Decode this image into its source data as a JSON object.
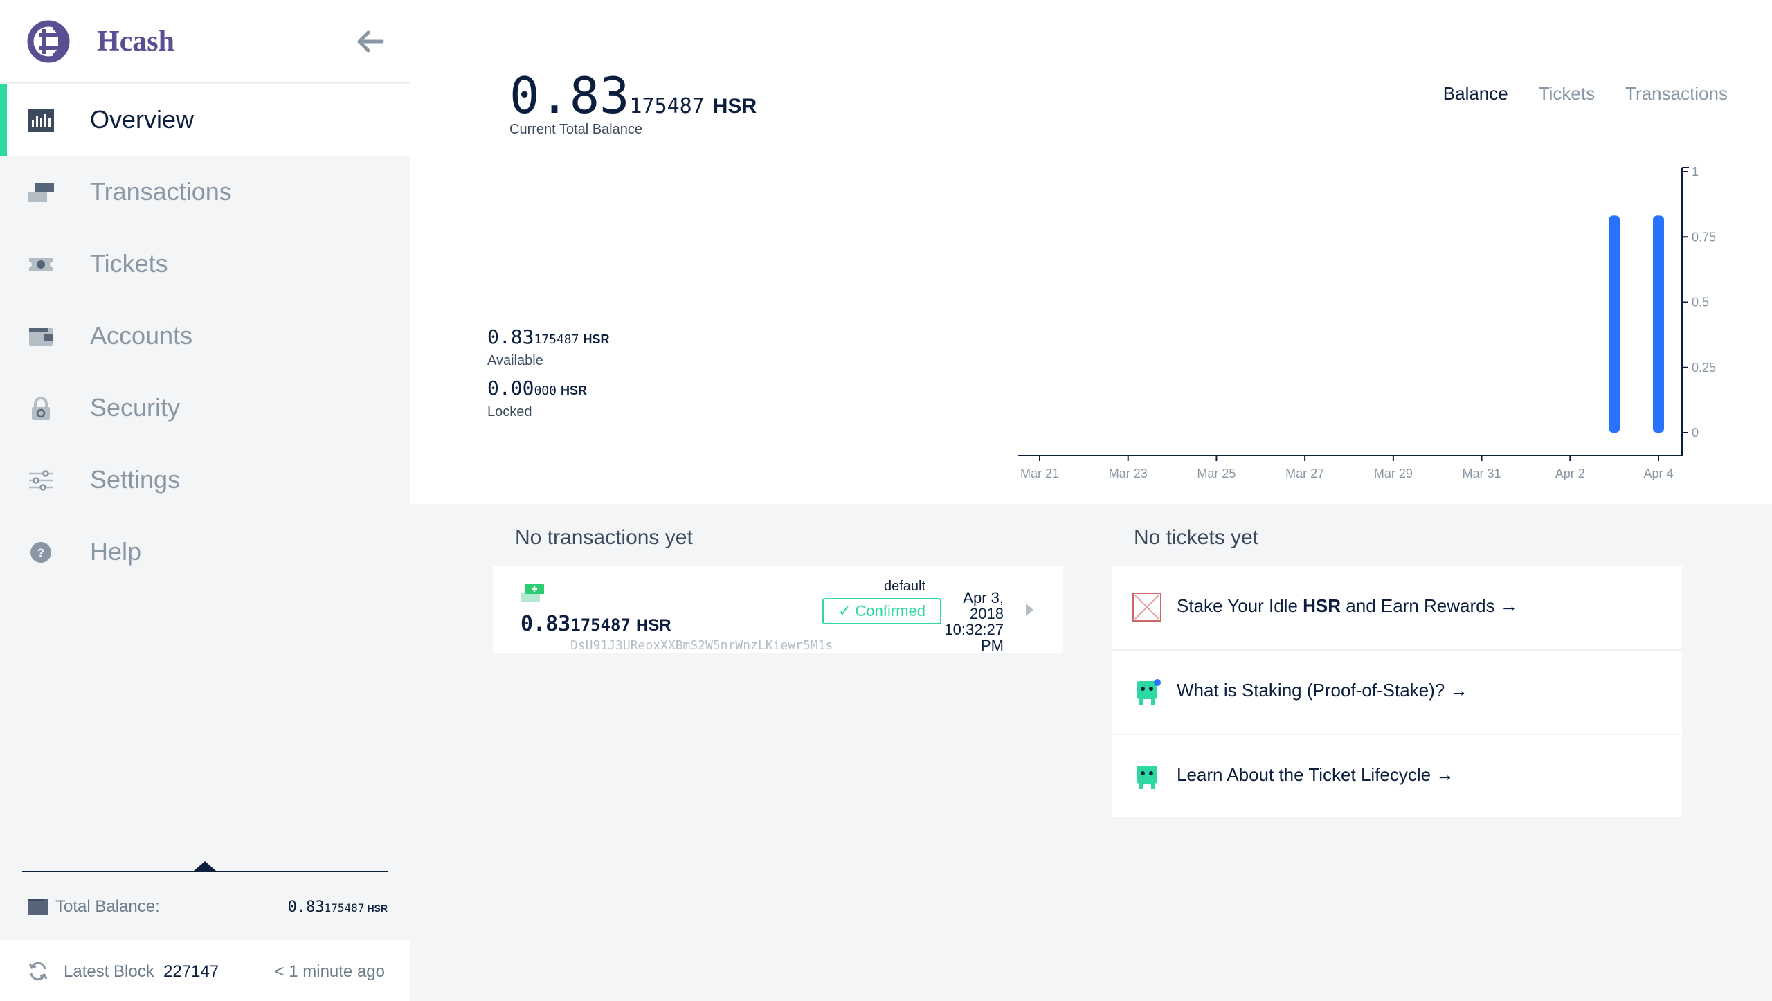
{
  "app": {
    "name": "Hcash"
  },
  "sidebar": {
    "items": [
      {
        "label": "Overview",
        "icon": "overview-icon",
        "active": true
      },
      {
        "label": "Transactions",
        "icon": "transactions-icon"
      },
      {
        "label": "Tickets",
        "icon": "tickets-icon"
      },
      {
        "label": "Accounts",
        "icon": "accounts-icon"
      },
      {
        "label": "Security",
        "icon": "lock-icon"
      },
      {
        "label": "Settings",
        "icon": "sliders-icon"
      },
      {
        "label": "Help",
        "icon": "help-icon"
      }
    ],
    "total_balance_label": "Total Balance:",
    "total_balance_int": "0.83",
    "total_balance_dec": "175487",
    "total_balance_unit": "HSR",
    "latest_block_label": "Latest Block",
    "latest_block_value": "227147",
    "latest_block_time": "< 1 minute ago"
  },
  "overview": {
    "balance_int": "0.83",
    "balance_dec": "175487",
    "unit": "HSR",
    "balance_caption": "Current Total Balance",
    "tabs": [
      "Balance",
      "Tickets",
      "Transactions"
    ],
    "active_tab": "Balance",
    "available_int": "0.83",
    "available_dec": "175487",
    "available_label": "Available",
    "locked_int": "0.00",
    "locked_dec": "000",
    "locked_label": "Locked"
  },
  "chart_data": {
    "type": "bar",
    "x_ticks": [
      "Mar 21",
      "Mar 23",
      "Mar 25",
      "Mar 27",
      "Mar 29",
      "Mar 31",
      "Apr 2",
      "Apr 4"
    ],
    "y_ticks": [
      "0",
      "0.25",
      "0.5",
      "0.75",
      "1"
    ],
    "ylim": [
      0,
      1
    ],
    "series": [
      {
        "values": [
          {
            "x": "Apr 3",
            "y": 0.83175487
          },
          {
            "x": "Apr 4",
            "y": 0.83175487
          }
        ]
      }
    ],
    "bar_color": "#2971ff",
    "grid": false
  },
  "transactions": {
    "title": "No transactions yet",
    "items": [
      {
        "amount_int": "0.83",
        "amount_dec": "175487",
        "unit": "HSR",
        "address": "DsU91J3UReoxXXBmS2W5nrWnzLKiewr5M1s",
        "account": "default",
        "status": "Confirmed",
        "date_line1": "Apr 3,",
        "date_line2": "2018",
        "date_line3": "10:32:27",
        "date_line4": "PM"
      }
    ]
  },
  "tickets": {
    "title": "No tickets yet",
    "items": [
      {
        "pre": "Stake Your Idle ",
        "bold": "HSR",
        "post": " and Earn Rewards →",
        "icon": "broken-image-icon"
      },
      {
        "pre": "What is Staking (Proof-of-Stake)? →",
        "bold": "",
        "post": "",
        "icon": "ticket-mascot-icon"
      },
      {
        "pre": "Learn About the Ticket Lifecycle →",
        "bold": "",
        "post": "",
        "icon": "ticket-lifecycle-icon"
      }
    ]
  },
  "colors": {
    "accent": "#2ed8a3",
    "brand": "#5b4e93",
    "text": "#0c1e3e",
    "muted": "#8997a5"
  }
}
